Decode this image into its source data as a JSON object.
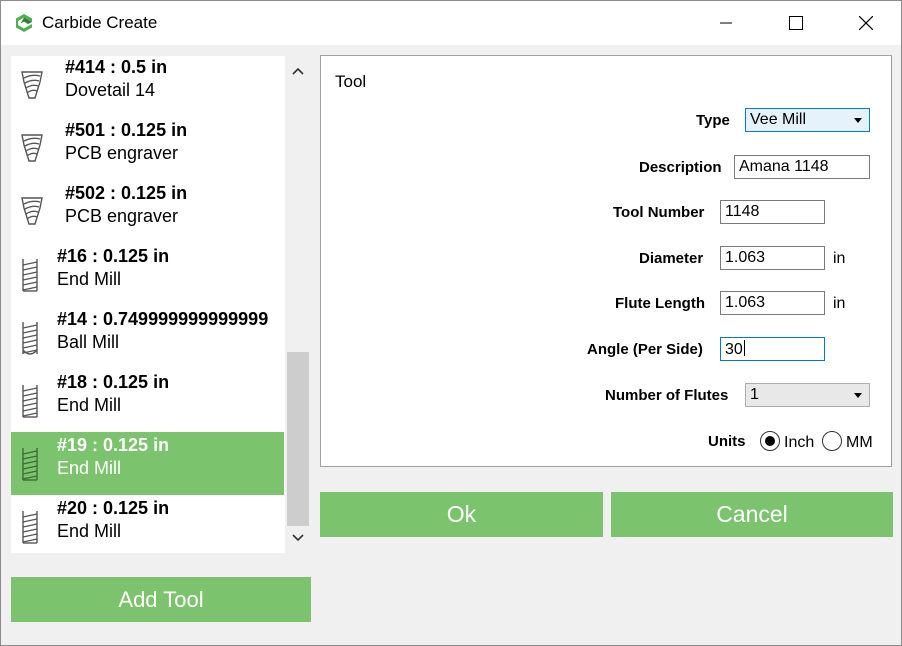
{
  "window": {
    "title": "Carbide Create",
    "accent_color": "#7cc36e"
  },
  "tool_list": {
    "items": [
      {
        "title": "#414 : 0.5 in",
        "subtitle": "Dovetail 14",
        "icon": "dovetail-tool-icon",
        "selected": false
      },
      {
        "title": "#501 : 0.125 in",
        "subtitle": "PCB engraver",
        "icon": "vbit-tool-icon",
        "selected": false
      },
      {
        "title": "#502 : 0.125 in",
        "subtitle": "PCB engraver",
        "icon": "vbit-tool-icon",
        "selected": false
      },
      {
        "title": "#16 : 0.125 in",
        "subtitle": "End Mill",
        "icon": "end-mill-icon",
        "selected": false
      },
      {
        "title": "#14 : 0.749999999999999",
        "subtitle": "Ball Mill",
        "icon": "ball-mill-icon",
        "selected": false
      },
      {
        "title": "#18 : 0.125 in",
        "subtitle": "End Mill",
        "icon": "end-mill-icon",
        "selected": false
      },
      {
        "title": "#19 : 0.125 in",
        "subtitle": "End Mill",
        "icon": "end-mill-icon",
        "selected": true
      },
      {
        "title": "#20 : 0.125 in",
        "subtitle": "End Mill",
        "icon": "end-mill-icon",
        "selected": false
      }
    ],
    "add_label": "Add Tool"
  },
  "tool_form": {
    "title": "Tool",
    "type_label": "Type",
    "type_value": "Vee Mill",
    "description_label": "Description",
    "description_value": "Amana 1148",
    "tool_number_label": "Tool Number",
    "tool_number_value": "1148",
    "diameter_label": "Diameter",
    "diameter_value": "1.063",
    "diameter_unit": "in",
    "flute_length_label": "Flute Length",
    "flute_length_value": "1.063",
    "flute_length_unit": "in",
    "angle_label": "Angle (Per Side)",
    "angle_value": "30",
    "flutes_label": "Number of Flutes",
    "flutes_value": "1",
    "units_label": "Units",
    "unit_inch": "Inch",
    "unit_mm": "MM",
    "selected_unit": "Inch"
  },
  "actions": {
    "ok_label": "Ok",
    "cancel_label": "Cancel"
  }
}
